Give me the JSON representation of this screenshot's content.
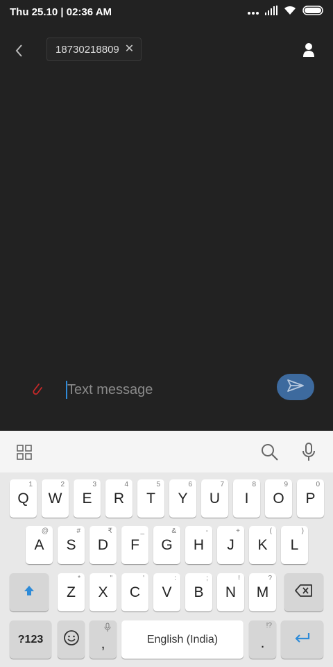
{
  "status_bar": {
    "time": "Thu 25.10 | 02:36 AM"
  },
  "header": {
    "recipient": "18730218809"
  },
  "compose": {
    "placeholder": "Text message"
  },
  "keyboard": {
    "row1": [
      {
        "label": "Q",
        "hint": "1"
      },
      {
        "label": "W",
        "hint": "2"
      },
      {
        "label": "E",
        "hint": "3"
      },
      {
        "label": "R",
        "hint": "4"
      },
      {
        "label": "T",
        "hint": "5"
      },
      {
        "label": "Y",
        "hint": "6"
      },
      {
        "label": "U",
        "hint": "7"
      },
      {
        "label": "I",
        "hint": "8"
      },
      {
        "label": "O",
        "hint": "9"
      },
      {
        "label": "P",
        "hint": "0"
      }
    ],
    "row2": [
      {
        "label": "A",
        "hint": "@"
      },
      {
        "label": "S",
        "hint": "#"
      },
      {
        "label": "D",
        "hint": "₹"
      },
      {
        "label": "F",
        "hint": "_"
      },
      {
        "label": "G",
        "hint": "&"
      },
      {
        "label": "H",
        "hint": "-"
      },
      {
        "label": "J",
        "hint": "+"
      },
      {
        "label": "K",
        "hint": "("
      },
      {
        "label": "L",
        "hint": ")"
      }
    ],
    "row3": [
      {
        "label": "Z",
        "hint": "*"
      },
      {
        "label": "X",
        "hint": "\""
      },
      {
        "label": "C",
        "hint": "'"
      },
      {
        "label": "V",
        "hint": ":"
      },
      {
        "label": "B",
        "hint": ";"
      },
      {
        "label": "N",
        "hint": "!"
      },
      {
        "label": "M",
        "hint": "?"
      }
    ],
    "symbols_label": "?123",
    "comma_label": ",",
    "space_label": "English (India)",
    "period_label": ".",
    "period_hint": "!?"
  }
}
